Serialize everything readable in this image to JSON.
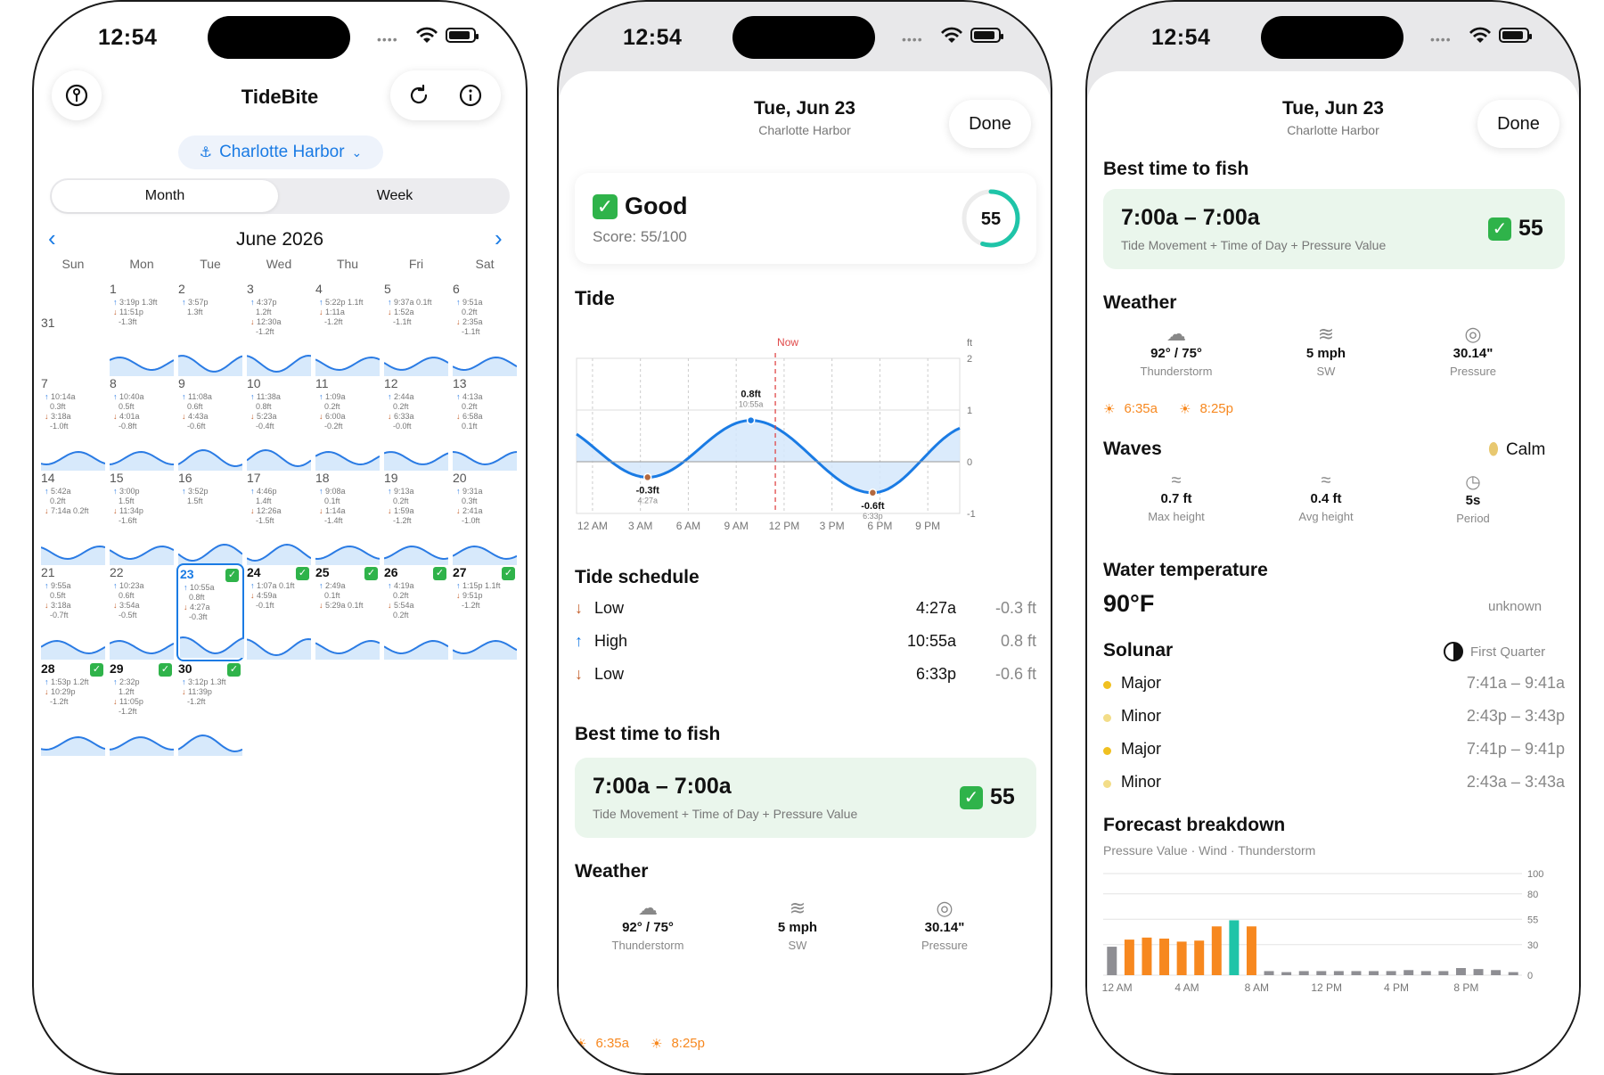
{
  "status": {
    "time": "12:54"
  },
  "cal": {
    "title": "TideBite",
    "location": "Charlotte Harbor",
    "seg_month": "Month",
    "seg_week": "Week",
    "month_label": "June 2026",
    "dow": [
      "Sun",
      "Mon",
      "Tue",
      "Wed",
      "Thu",
      "Fri",
      "Sat"
    ],
    "days": [
      {
        "n": "31",
        "l": []
      },
      {
        "n": "1",
        "l": [
          [
            "u",
            "3:19p 1.3ft"
          ],
          [
            "d",
            "11:51p"
          ],
          [
            "d2",
            "-1.3ft"
          ]
        ]
      },
      {
        "n": "2",
        "l": [
          [
            "u",
            "3:57p"
          ],
          [
            "u2",
            "1.3ft"
          ]
        ]
      },
      {
        "n": "3",
        "l": [
          [
            "u",
            "4:37p"
          ],
          [
            "u2",
            "1.2ft"
          ],
          [
            "d",
            "12:30a"
          ],
          [
            "d2",
            "-1.2ft"
          ]
        ]
      },
      {
        "n": "4",
        "l": [
          [
            "u",
            "5:22p 1.1ft"
          ],
          [
            "d",
            "1:11a"
          ],
          [
            "d2",
            "-1.2ft"
          ]
        ]
      },
      {
        "n": "5",
        "l": [
          [
            "u",
            "9:37a 0.1ft"
          ],
          [
            "d",
            "1:52a"
          ],
          [
            "d2",
            "-1.1ft"
          ]
        ]
      },
      {
        "n": "6",
        "l": [
          [
            "u",
            "9:51a"
          ],
          [
            "u2",
            "0.2ft"
          ],
          [
            "d",
            "2:35a"
          ],
          [
            "d2",
            "-1.1ft"
          ]
        ]
      },
      {
        "n": "7",
        "l": [
          [
            "u",
            "10:14a"
          ],
          [
            "u2",
            "0.3ft"
          ],
          [
            "d",
            "3:18a"
          ],
          [
            "d2",
            "-1.0ft"
          ]
        ]
      },
      {
        "n": "8",
        "l": [
          [
            "u",
            "10:40a"
          ],
          [
            "u2",
            "0.5ft"
          ],
          [
            "d",
            "4:01a"
          ],
          [
            "d2",
            "-0.8ft"
          ]
        ]
      },
      {
        "n": "9",
        "l": [
          [
            "u",
            "11:08a"
          ],
          [
            "u2",
            "0.6ft"
          ],
          [
            "d",
            "4:43a"
          ],
          [
            "d2",
            "-0.6ft"
          ]
        ]
      },
      {
        "n": "10",
        "l": [
          [
            "u",
            "11:38a"
          ],
          [
            "u2",
            "0.8ft"
          ],
          [
            "d",
            "5:23a"
          ],
          [
            "d2",
            "-0.4ft"
          ]
        ]
      },
      {
        "n": "11",
        "l": [
          [
            "u",
            "1:09a"
          ],
          [
            "u2",
            "0.2ft"
          ],
          [
            "d",
            "6:00a"
          ],
          [
            "d2",
            "-0.2ft"
          ]
        ]
      },
      {
        "n": "12",
        "l": [
          [
            "u",
            "2:44a"
          ],
          [
            "u2",
            "0.2ft"
          ],
          [
            "d",
            "6:33a"
          ],
          [
            "d2",
            "-0.0ft"
          ]
        ]
      },
      {
        "n": "13",
        "l": [
          [
            "u",
            "4:13a"
          ],
          [
            "u2",
            "0.2ft"
          ],
          [
            "d",
            "6:58a"
          ],
          [
            "d2",
            "0.1ft"
          ]
        ]
      },
      {
        "n": "14",
        "l": [
          [
            "u",
            "5:42a"
          ],
          [
            "u2",
            "0.2ft"
          ],
          [
            "d",
            "7:14a 0.2ft"
          ]
        ]
      },
      {
        "n": "15",
        "l": [
          [
            "u",
            "3:00p"
          ],
          [
            "u2",
            "1.5ft"
          ],
          [
            "d",
            "11:34p"
          ],
          [
            "d2",
            "-1.6ft"
          ]
        ]
      },
      {
        "n": "16",
        "l": [
          [
            "u",
            "3:52p"
          ],
          [
            "u2",
            "1.5ft"
          ]
        ]
      },
      {
        "n": "17",
        "l": [
          [
            "u",
            "4:46p"
          ],
          [
            "u2",
            "1.4ft"
          ],
          [
            "d",
            "12:26a"
          ],
          [
            "d2",
            "-1.5ft"
          ]
        ]
      },
      {
        "n": "18",
        "l": [
          [
            "u",
            "9:08a"
          ],
          [
            "u2",
            "0.1ft"
          ],
          [
            "d",
            "1:14a"
          ],
          [
            "d2",
            "-1.4ft"
          ]
        ]
      },
      {
        "n": "19",
        "l": [
          [
            "u",
            "9:13a"
          ],
          [
            "u2",
            "0.2ft"
          ],
          [
            "d",
            "1:59a"
          ],
          [
            "d2",
            "-1.2ft"
          ]
        ]
      },
      {
        "n": "20",
        "l": [
          [
            "u",
            "9:31a"
          ],
          [
            "u2",
            "0.3ft"
          ],
          [
            "d",
            "2:41a"
          ],
          [
            "d2",
            "-1.0ft"
          ]
        ]
      },
      {
        "n": "21",
        "l": [
          [
            "u",
            "9:55a"
          ],
          [
            "u2",
            "0.5ft"
          ],
          [
            "d",
            "3:18a"
          ],
          [
            "d2",
            "-0.7ft"
          ]
        ]
      },
      {
        "n": "22",
        "l": [
          [
            "u",
            "10:23a"
          ],
          [
            "u2",
            "0.6ft"
          ],
          [
            "d",
            "3:54a"
          ],
          [
            "d2",
            "-0.5ft"
          ]
        ]
      },
      {
        "n": "23",
        "sel": true,
        "ck": true,
        "l": [
          [
            "u",
            "10:55a"
          ],
          [
            "u2",
            "0.8ft"
          ],
          [
            "d",
            "4:27a"
          ],
          [
            "d2",
            "-0.3ft"
          ]
        ]
      },
      {
        "n": "24",
        "ck": true,
        "l": [
          [
            "u",
            "1:07a 0.1ft"
          ],
          [
            "d",
            "4:59a"
          ],
          [
            "d2",
            "-0.1ft"
          ]
        ]
      },
      {
        "n": "25",
        "ck": true,
        "l": [
          [
            "u",
            "2:49a"
          ],
          [
            "u2",
            "0.1ft"
          ],
          [
            "d",
            "5:29a 0.1ft"
          ]
        ]
      },
      {
        "n": "26",
        "ck": true,
        "l": [
          [
            "u",
            "4:19a"
          ],
          [
            "u2",
            "0.2ft"
          ],
          [
            "d",
            "5:54a"
          ],
          [
            "d2",
            "0.2ft"
          ]
        ]
      },
      {
        "n": "27",
        "ck": true,
        "l": [
          [
            "u",
            "1:15p 1.1ft"
          ],
          [
            "d",
            "9:51p"
          ],
          [
            "d2",
            "-1.2ft"
          ]
        ]
      },
      {
        "n": "28",
        "ck": true,
        "l": [
          [
            "u",
            "1:53p 1.2ft"
          ],
          [
            "d",
            "10:29p"
          ],
          [
            "d2",
            "-1.2ft"
          ]
        ]
      },
      {
        "n": "29",
        "ck": true,
        "l": [
          [
            "u",
            "2:32p"
          ],
          [
            "u2",
            "1.2ft"
          ],
          [
            "d",
            "11:05p"
          ],
          [
            "d2",
            "-1.2ft"
          ]
        ]
      },
      {
        "n": "30",
        "ck": true,
        "l": [
          [
            "u",
            "3:12p 1.3ft"
          ],
          [
            "d",
            "11:39p"
          ],
          [
            "d2",
            "-1.2ft"
          ]
        ]
      }
    ]
  },
  "detail": {
    "date": "Tue, Jun 23",
    "location": "Charlotte Harbor",
    "done": "Done",
    "rating": "Good",
    "score_text": "Score: 55/100",
    "score": "55",
    "score_value": 55,
    "tide_title": "Tide",
    "schedule_title": "Tide schedule",
    "schedule": [
      {
        "dir": "down",
        "label": "Low",
        "time": "4:27a",
        "height": "-0.3 ft"
      },
      {
        "dir": "up",
        "label": "High",
        "time": "10:55a",
        "height": "0.8 ft"
      },
      {
        "dir": "down",
        "label": "Low",
        "time": "6:33p",
        "height": "-0.6 ft"
      }
    ],
    "best_title": "Best time to fish",
    "best_window": "7:00a – 7:00a",
    "best_factors": "Tide Movement + Time of Day + Pressure Value",
    "best_score": "55",
    "weather_title": "Weather",
    "temp": "92° / 75°",
    "condition": "Thunderstorm",
    "wind": "5 mph",
    "wind_dir": "SW",
    "pressure": "30.14\"",
    "pressure_label": "Pressure",
    "sunrise": "6:35a",
    "sunset": "8:25p",
    "waves_title": "Waves",
    "waves_state": "Calm",
    "max_height": "0.7 ft",
    "max_label": "Max height",
    "avg_height": "0.4 ft",
    "avg_label": "Avg height",
    "period": "5s",
    "period_label": "Period",
    "water_title": "Water temperature",
    "water_temp": "90°F",
    "water_note": "unknown",
    "solunar_title": "Solunar",
    "moon": "First Quarter",
    "solunar": [
      {
        "label": "Major",
        "range": "7:41a – 9:41a",
        "color": "#f0c020"
      },
      {
        "label": "Minor",
        "range": "2:43p – 3:43p",
        "color": "#f3dd88"
      },
      {
        "label": "Major",
        "range": "7:41p – 9:41p",
        "color": "#f0c020"
      },
      {
        "label": "Minor",
        "range": "2:43a – 3:43a",
        "color": "#f3dd88"
      }
    ],
    "forecast_title": "Forecast breakdown",
    "forecast_sub": "Pressure Value · Wind · Thunderstorm"
  },
  "chart_data": [
    {
      "type": "line",
      "title": "Tide",
      "unit": "ft",
      "x_ticks": [
        "12 AM",
        "3 AM",
        "6 AM",
        "9 AM",
        "12 PM",
        "3 PM",
        "6 PM",
        "9 PM"
      ],
      "y_ticks": [
        2,
        1,
        0,
        -1
      ],
      "ylim": [
        -1,
        2
      ],
      "now_label": "Now",
      "now_hour": 12.45,
      "points": [
        {
          "hour": 4.45,
          "value": -0.3
        },
        {
          "hour": 10.92,
          "value": 0.8
        },
        {
          "hour": 18.55,
          "value": -0.6
        }
      ],
      "annotations": [
        {
          "hour": 4.45,
          "value": -0.3,
          "label": "-0.3ft",
          "time": "4:27a"
        },
        {
          "hour": 10.92,
          "value": 0.8,
          "label": "0.8ft",
          "time": "10:55a"
        },
        {
          "hour": 18.55,
          "value": -0.6,
          "label": "-0.6ft",
          "time": "6:33p"
        }
      ]
    },
    {
      "type": "bar",
      "title": "Forecast breakdown",
      "x_ticks": [
        "12 AM",
        "4 AM",
        "8 AM",
        "12 PM",
        "4 PM",
        "8 PM"
      ],
      "y_ticks": [
        100,
        80,
        55,
        30,
        0
      ],
      "ylim": [
        0,
        100
      ],
      "hours": [
        0,
        1,
        2,
        3,
        4,
        5,
        6,
        7,
        8,
        9,
        10,
        11,
        12,
        13,
        14,
        15,
        16,
        17,
        18,
        19,
        20,
        21,
        22,
        23
      ],
      "values": [
        28,
        35,
        37,
        36,
        33,
        34,
        48,
        54,
        48,
        4,
        3,
        4,
        4,
        4,
        4,
        4,
        4,
        5,
        4,
        4,
        7,
        6,
        5,
        3
      ],
      "colors": [
        "#8e8e93",
        "#f7881f",
        "#f7881f",
        "#f7881f",
        "#f7881f",
        "#f7881f",
        "#f7881f",
        "#1fc4a8",
        "#f7881f",
        "#8e8e93",
        "#8e8e93",
        "#8e8e93",
        "#8e8e93",
        "#8e8e93",
        "#8e8e93",
        "#8e8e93",
        "#8e8e93",
        "#8e8e93",
        "#8e8e93",
        "#8e8e93",
        "#8e8e93",
        "#8e8e93",
        "#8e8e93",
        "#8e8e93"
      ]
    }
  ],
  "colors": {
    "accent": "#1a7be4",
    "teal": "#1fc4a8",
    "green": "#2fb34a",
    "orange": "#f7881f",
    "bestbg": "#eaf6ec"
  }
}
